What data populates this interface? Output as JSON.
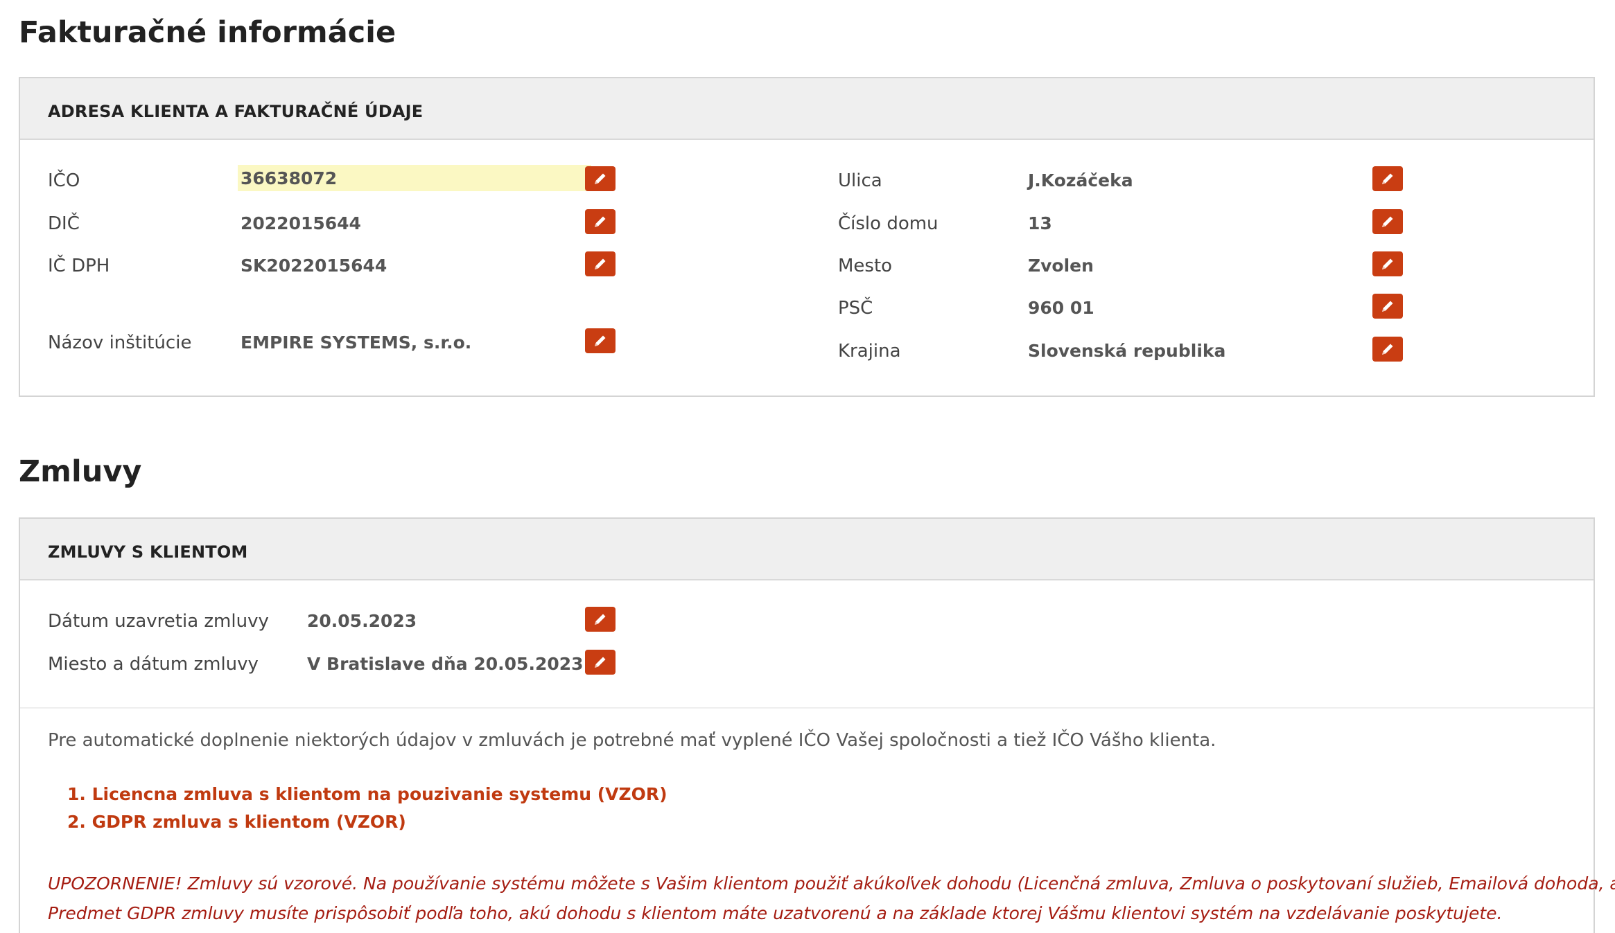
{
  "billing": {
    "title": "Fakturačné informácie",
    "panel_title": "ADRESA KLIENTA A FAKTURAČNÉ ÚDAJE",
    "left": [
      {
        "label": "IČO",
        "value": "36638072"
      },
      {
        "label": "DIČ",
        "value": "2022015644"
      },
      {
        "label": "IČ DPH",
        "value": "SK2022015644"
      },
      {
        "label": "Názov inštitúcie",
        "value": "EMPIRE SYSTEMS, s.r.o."
      }
    ],
    "right": [
      {
        "label": "Ulica",
        "value": "J.Kozáčeka"
      },
      {
        "label": "Číslo domu",
        "value": "13"
      },
      {
        "label": "Mesto",
        "value": "Zvolen"
      },
      {
        "label": "PSČ",
        "value": "960 01"
      },
      {
        "label": "Krajina",
        "value": "Slovenská republika"
      }
    ]
  },
  "contracts": {
    "title": "Zmluvy",
    "panel_title": "ZMLUVY S KLIENTOM",
    "rows": [
      {
        "label": "Dátum uzavretia zmluvy",
        "value": "20.05.2023"
      },
      {
        "label": "Miesto a dátum zmluvy",
        "value": "V Bratislave dňa 20.05.2023"
      }
    ],
    "info": "Pre automatické doplnenie niektorých údajov v zmluvách je potrebné mať vyplené IČO Vašej spoločnosti a tiež IČO Vášho klienta.",
    "documents": [
      "1. Licencna zmluva s klientom na pouzivanie systemu (VZOR)",
      "2. GDPR zmluva s klientom (VZOR)"
    ],
    "warning_line1": "UPOZORNENIE! Zmluvy sú vzorové. Na používanie systému môžete s Vašim klientom použiť akúkoľvek dohodu (Licenčná zmluva, Zmluva o poskytovaní služieb, Emailová dohoda, atď.)",
    "warning_line2": "Predmet GDPR zmluvy musíte prispôsobiť podľa toho, akú dohodu s klientom máte uzatvorenú a na základe ktorej Vášmu klientovi systém na vzdelávanie poskytujete."
  },
  "icons": {
    "edit": "pencil-icon",
    "edit_button_color": "#c93d12",
    "highlight_color": "#fbf8c3",
    "link_color": "#c03a10",
    "warning_color": "#a51d12"
  }
}
